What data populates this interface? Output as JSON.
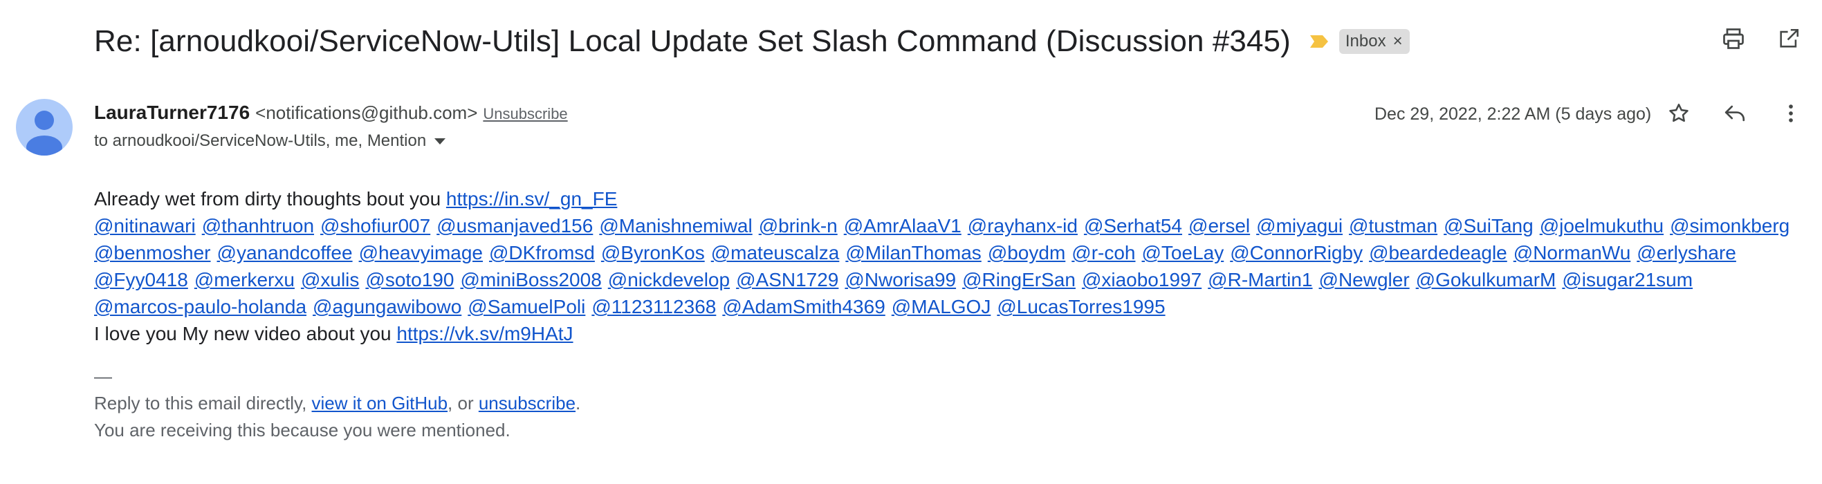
{
  "subject": "Re: [arnoudkooi/ServiceNow-Utils] Local Update Set Slash Command (Discussion #345)",
  "label": {
    "name": "Inbox",
    "remove": "×"
  },
  "colors": {
    "importance": "#f5c242",
    "link": "#1155cc",
    "avatar_bg": "#aecbfa",
    "avatar_fg": "#4a7de2"
  },
  "top_icons": [
    "print-icon",
    "open-in-new-window-icon"
  ],
  "sender": {
    "name": "LauraTurner7176",
    "email": "<notifications@github.com>",
    "unsubscribe": "Unsubscribe",
    "to": "to arnoudkooi/ServiceNow-Utils, me, Mention",
    "date": "Dec 29, 2022, 2:22 AM (5 days ago)"
  },
  "message_icons": [
    "star-icon",
    "reply-icon",
    "more-vert-icon"
  ],
  "body": {
    "line1_text": "Already wet from dirty thoughts bout you ",
    "line1_link": "https://in.sv/_gn_FE",
    "mentions": [
      "@nitinawari",
      "@thanhtruon",
      "@shofiur007",
      "@usmanjaved156",
      "@Manishnemiwal",
      "@brink-n",
      "@AmrAlaaV1",
      "@rayhanx-id",
      "@Serhat54",
      "@ersel",
      "@miyagui",
      "@tustman",
      "@SuiTang",
      "@joelmukuthu",
      "@simonkberg",
      "@benmosher",
      "@yanandcoffee",
      "@heavyimage",
      "@DKfromsd",
      "@ByronKos",
      "@mateuscalza",
      "@MilanThomas",
      "@boydm",
      "@r-coh",
      "@ToeLay",
      "@ConnorRigby",
      "@beardedeagle",
      "@NormanWu",
      "@erlyshare",
      "@Fyy0418",
      "@merkerxu",
      "@xulis",
      "@soto190",
      "@miniBoss2008",
      "@nickdevelop",
      "@ASN1729",
      "@Nworisa99",
      "@RingErSan",
      "@xiaobo1997",
      "@R-Martin1",
      "@Newgler",
      "@GokulkumarM",
      "@isugar21sum",
      "@marcos-paulo-holanda",
      "@agungawibowo",
      "@SamuelPoli",
      "@1123112368",
      "@AdamSmith4369",
      "@MALGOJ",
      "@LucasTorres1995"
    ],
    "line_last_text": "I love you My new video about you ",
    "line_last_link": "https://vk.sv/m9HAtJ"
  },
  "footer": {
    "dash": "—",
    "reply_prefix": "Reply to this email directly, ",
    "view_link": "view it on GitHub",
    "or_text": ", or ",
    "unsub_link": "unsubscribe",
    "period": ".",
    "notice": "You are receiving this because you were mentioned."
  }
}
